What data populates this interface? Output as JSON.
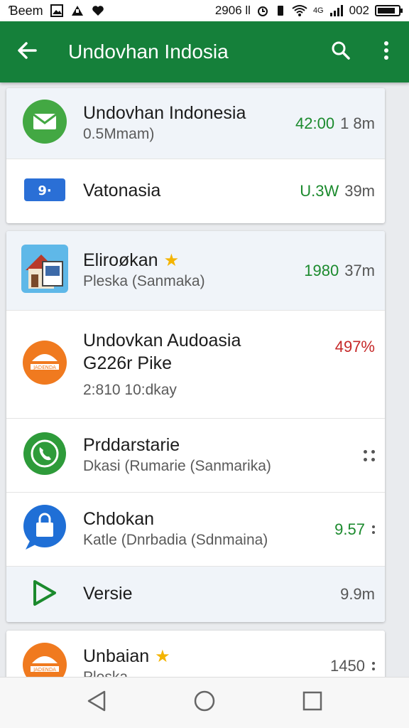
{
  "status_bar": {
    "carrier": "Ɓeem",
    "time": "2906 ll",
    "signal_label": "4G",
    "battery_text": "002",
    "battery_level": 0.85
  },
  "toolbar": {
    "title": "Undovhan Indosia",
    "back_icon": "arrow-left-icon",
    "search_icon": "search-icon",
    "more_icon": "more-vert-icon"
  },
  "cards": [
    {
      "rows": [
        {
          "icon": "mail-icon",
          "icon_color": "#43a843",
          "title": "Undovhan Indonesia",
          "subtitle": "0.5Mmam)",
          "value": "42:00",
          "unit": "1 8m",
          "highlight": true
        },
        {
          "icon": "badge-9-icon",
          "icon_color": "#2a6fd6",
          "title": "Vatonasia",
          "value": "U.3W",
          "unit": "39m",
          "highlight": false
        }
      ]
    },
    {
      "rows": [
        {
          "icon": "house-icon",
          "title": "Eliroøkan",
          "title_color": "#c62828",
          "starred": true,
          "subtitle": "Pleska (Sanmaka)",
          "value": "1980",
          "unit": "37m",
          "highlight": true
        },
        {
          "icon": "jadenda-icon",
          "icon_color": "#f07a1f",
          "title": "Undovkan Audoasia",
          "subtitle": "G226r Pike",
          "meta": "2:810 10:dkay",
          "value": "497%",
          "highlight": false
        },
        {
          "icon": "phone-icon",
          "icon_color": "#2e9b3a",
          "title": "Prddarstarie",
          "subtitle": "Dkasi (Rumarie (Sanmarika)",
          "highlight": false
        },
        {
          "icon": "shopping-bag-icon",
          "icon_color": "#1f6fd6",
          "title": "Chdokan",
          "subtitle": "Katle (Dnrbadia (Sdnmaina)",
          "value": "9.57",
          "highlight": false
        },
        {
          "icon": "play-icon",
          "icon_color": "#1b8a2d",
          "title": "Versie",
          "unit": "9.9m",
          "highlight": true
        }
      ]
    },
    {
      "rows": [
        {
          "icon": "jadenda-icon",
          "icon_color": "#f07a1f",
          "title": "Unbaian",
          "starred": true,
          "subtitle": "Pleska",
          "value": "1450",
          "highlight": false
        }
      ]
    }
  ],
  "nav": {
    "back_icon": "nav-back-icon",
    "home_icon": "nav-home-icon",
    "recents_icon": "nav-recents-icon"
  }
}
